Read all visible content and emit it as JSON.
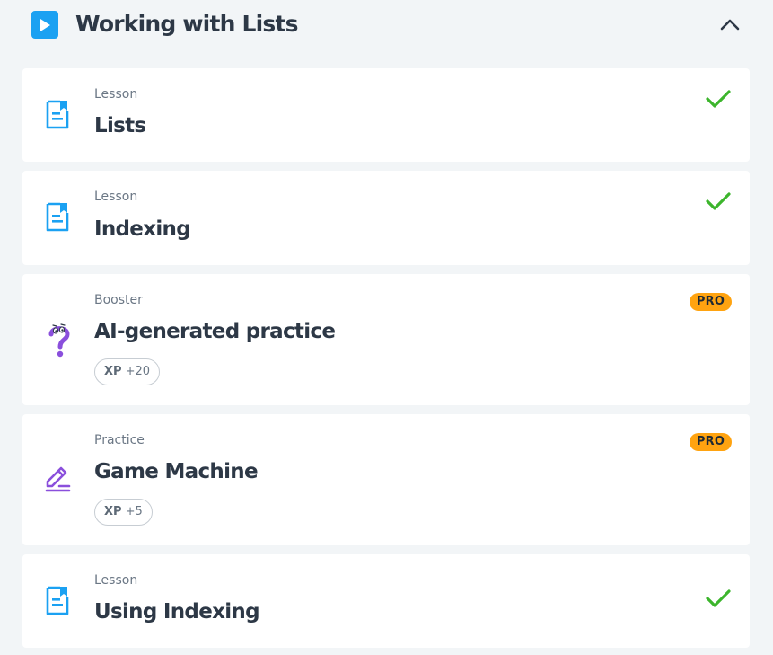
{
  "module": {
    "title": "Working with Lists",
    "play_icon": "play-icon",
    "collapse_icon": "chevron-up-icon"
  },
  "items": [
    {
      "type": "Lesson",
      "title": "Lists",
      "icon": "lesson-document-icon",
      "status": "completed"
    },
    {
      "type": "Lesson",
      "title": "Indexing",
      "icon": "lesson-document-icon",
      "status": "completed"
    },
    {
      "type": "Booster",
      "title": "AI-generated practice",
      "icon": "question-mark-icon",
      "badge": "PRO",
      "xp_label": "XP",
      "xp_value": "+20"
    },
    {
      "type": "Practice",
      "title": "Game Machine",
      "icon": "pencil-icon",
      "badge": "PRO",
      "xp_label": "XP",
      "xp_value": "+5"
    },
    {
      "type": "Lesson",
      "title": "Using Indexing",
      "icon": "lesson-document-icon",
      "status": "completed"
    }
  ],
  "colors": {
    "accent_blue": "#1ba1f2",
    "check_green": "#3cb52c",
    "pro_orange": "#ffa310",
    "practice_purple": "#8a4fdc",
    "title_text": "#2d3846"
  }
}
